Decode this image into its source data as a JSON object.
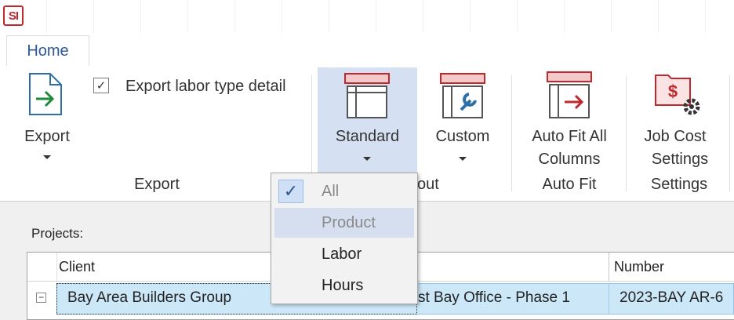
{
  "app": {
    "logo_text": "SI"
  },
  "tabs": [
    {
      "label": "Home"
    }
  ],
  "ribbon": {
    "export_button": "Export",
    "export_labor_checkbox": {
      "label": "Export labor type detail",
      "checked": true
    },
    "export_group_label": "Export",
    "standard_button": "Standard",
    "custom_button": "Custom",
    "layout_group_label_visible": "out",
    "autofit_button_line1": "Auto Fit All",
    "autofit_button_line2": "Columns",
    "autofit_group_label": "Auto Fit",
    "jobcost_button_line1": "Job Cost",
    "jobcost_button_line2": "Settings",
    "settings_group_label": "Settings"
  },
  "dropdown": {
    "items": [
      {
        "label": "All",
        "checked": true,
        "disabled": true
      },
      {
        "label": "Product",
        "highlighted": true,
        "disabled": true
      },
      {
        "label": "Labor"
      },
      {
        "label": "Hours"
      }
    ]
  },
  "projects": {
    "label": "Projects:",
    "columns": [
      "Client",
      "Number"
    ],
    "rows": [
      {
        "expander": "⊟",
        "client": "Bay Area Builders Group",
        "project_visible": "st Bay Office - Phase 1",
        "number_visible": "2023-BAY AR-6"
      }
    ]
  },
  "colors": {
    "accent": "#2b579a",
    "brand_red": "#c0282d",
    "selection": "#cce8f8",
    "ribbon_highlight": "#d5e1f2"
  }
}
